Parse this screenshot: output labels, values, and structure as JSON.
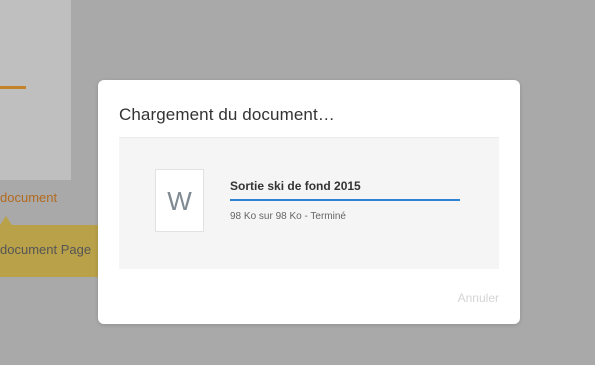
{
  "background": {
    "doc_label": "document",
    "tooltip_text": "document Page"
  },
  "dialog": {
    "title": "Chargement du document…",
    "file": {
      "icon_letter": "W",
      "icon_name": "word-document-icon",
      "name": "Sortie ski de fond 2015",
      "status": "98 Ko sur 98 Ko - Terminé",
      "progress": 1.0
    },
    "cancel_label": "Annuler"
  },
  "colors": {
    "progress": "#2d82d6",
    "accent_orange": "#c4822a",
    "tooltip": "#b9a14a"
  }
}
